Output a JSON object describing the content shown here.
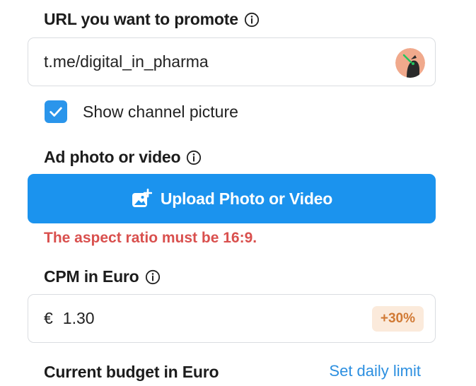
{
  "url_section": {
    "label": "URL you want to promote",
    "info_icon": "info-circle-icon",
    "value": "t.me/digital_in_pharma",
    "avatar": "channel-avatar"
  },
  "show_picture": {
    "checked": true,
    "label": "Show channel picture"
  },
  "media_section": {
    "label": "Ad photo or video",
    "info_icon": "info-circle-icon",
    "upload_button_label": "Upload Photo or Video",
    "upload_icon": "add-photo-icon",
    "error": "The aspect ratio must be 16:9."
  },
  "cpm_section": {
    "label": "CPM in Euro",
    "info_icon": "info-circle-icon",
    "currency_symbol": "€",
    "value": "1.30",
    "badge": "+30%"
  },
  "budget_section": {
    "label": "Current budget in Euro",
    "link": "Set daily limit"
  },
  "colors": {
    "primary": "#1b93ee",
    "error": "#d9504e",
    "badge_bg": "#fbeadb",
    "badge_text": "#d17a35",
    "link": "#2c8fe0"
  }
}
